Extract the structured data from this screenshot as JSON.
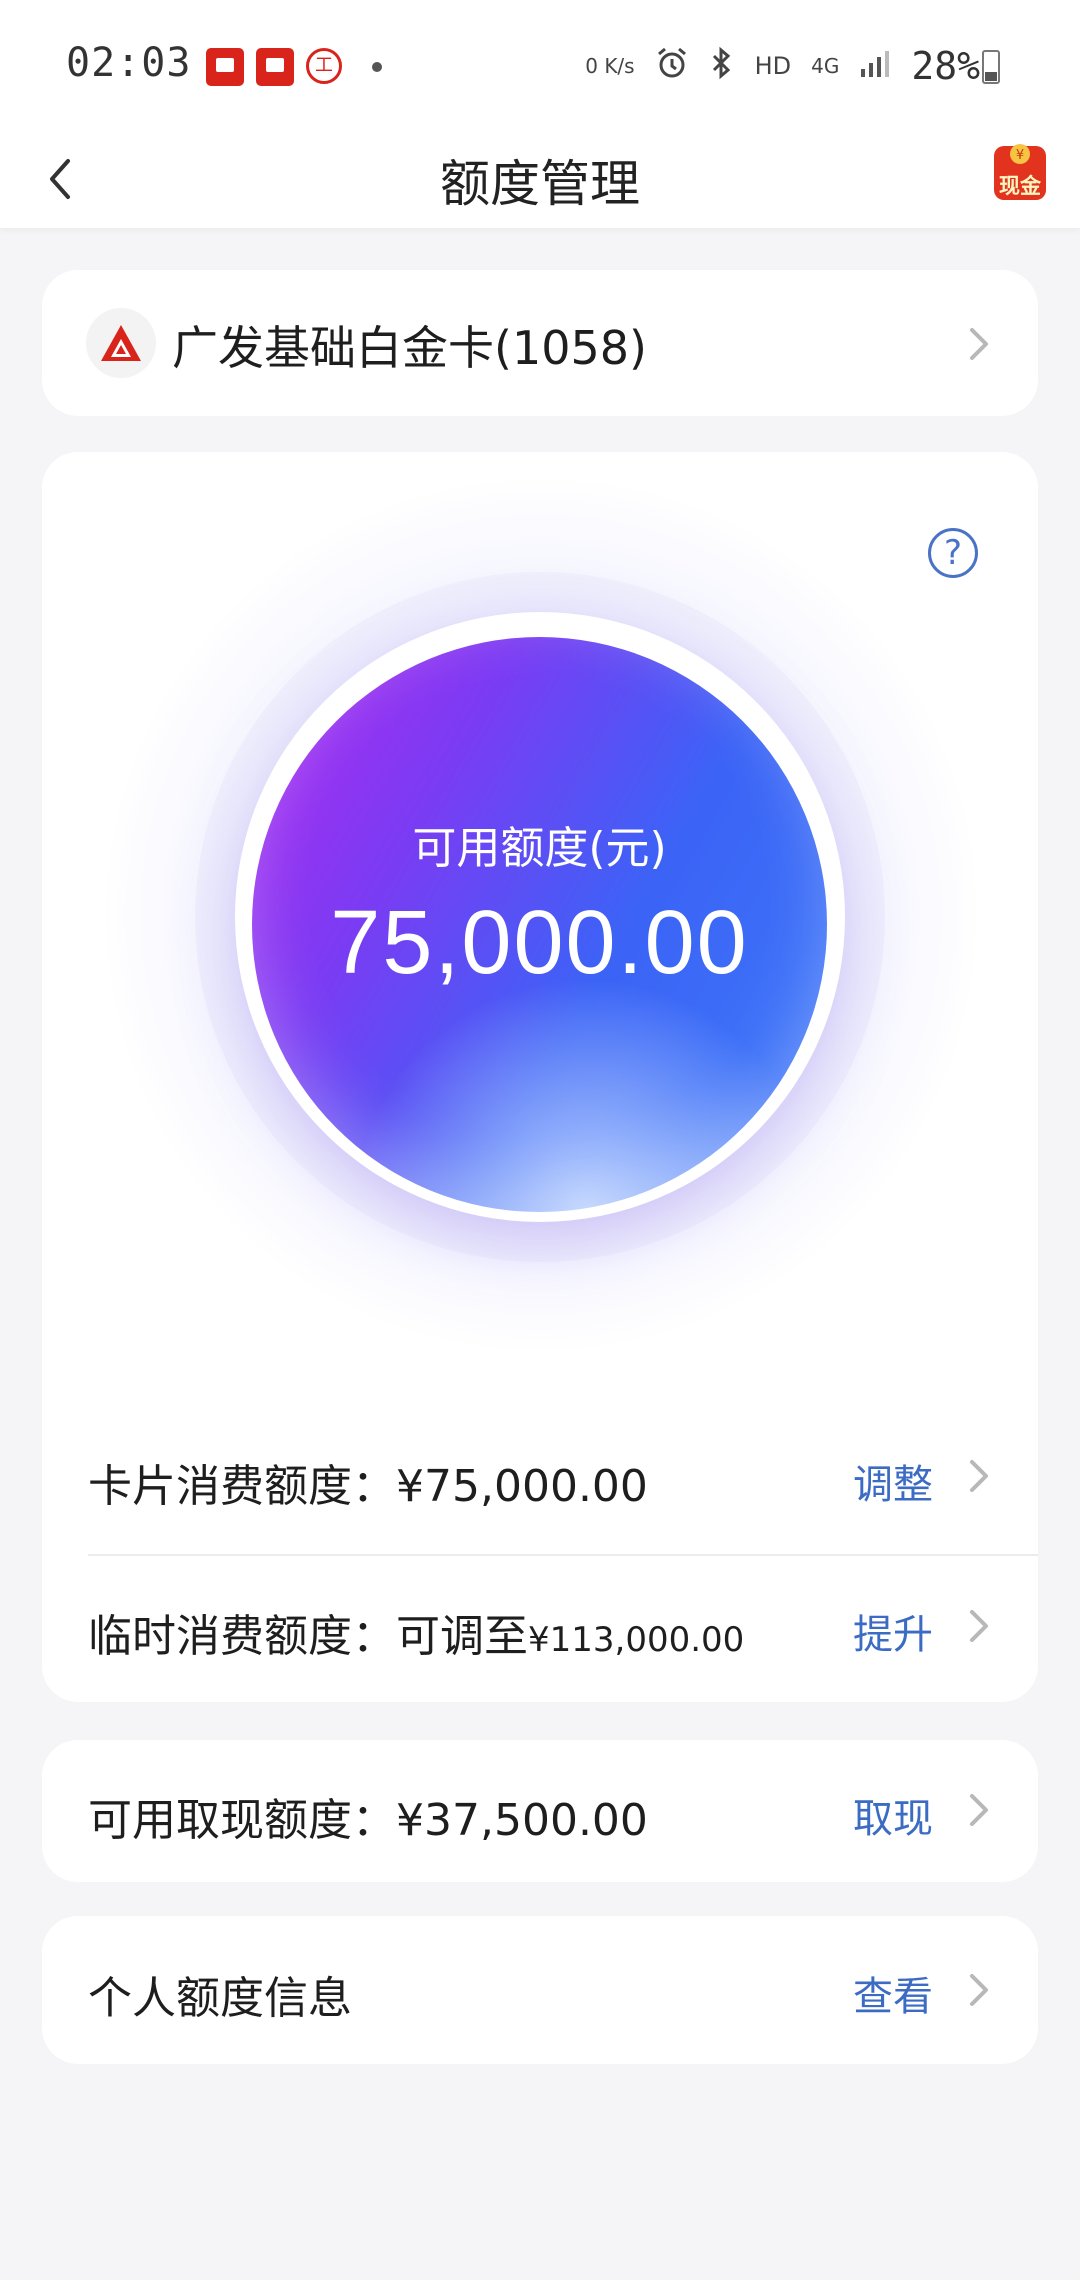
{
  "status_bar": {
    "time": "02:03",
    "net_speed": "0 K/s",
    "hd": "HD",
    "network": "4G",
    "battery": "28%"
  },
  "nav": {
    "title": "额度管理",
    "cash_badge": "现金"
  },
  "card_select": {
    "card_name": "广发基础白金卡(1058)"
  },
  "limit_circle": {
    "label": "可用额度(元)",
    "value": "75,000.00"
  },
  "rows": {
    "spend_limit": {
      "label": "卡片消费额度：¥75,000.00",
      "action": "调整"
    },
    "temp_limit": {
      "label": "临时消费额度：可调至",
      "amount": "¥113,000.00",
      "action": "提升"
    },
    "cash_limit": {
      "label": "可用取现额度：¥37,500.00",
      "action": "取现"
    },
    "personal_info": {
      "label": "个人额度信息",
      "action": "查看"
    }
  },
  "colors": {
    "accent": "#3c6bc4",
    "orb_start": "#b128f0",
    "orb_end": "#3f7cf9",
    "brand_red": "#d8241b"
  }
}
